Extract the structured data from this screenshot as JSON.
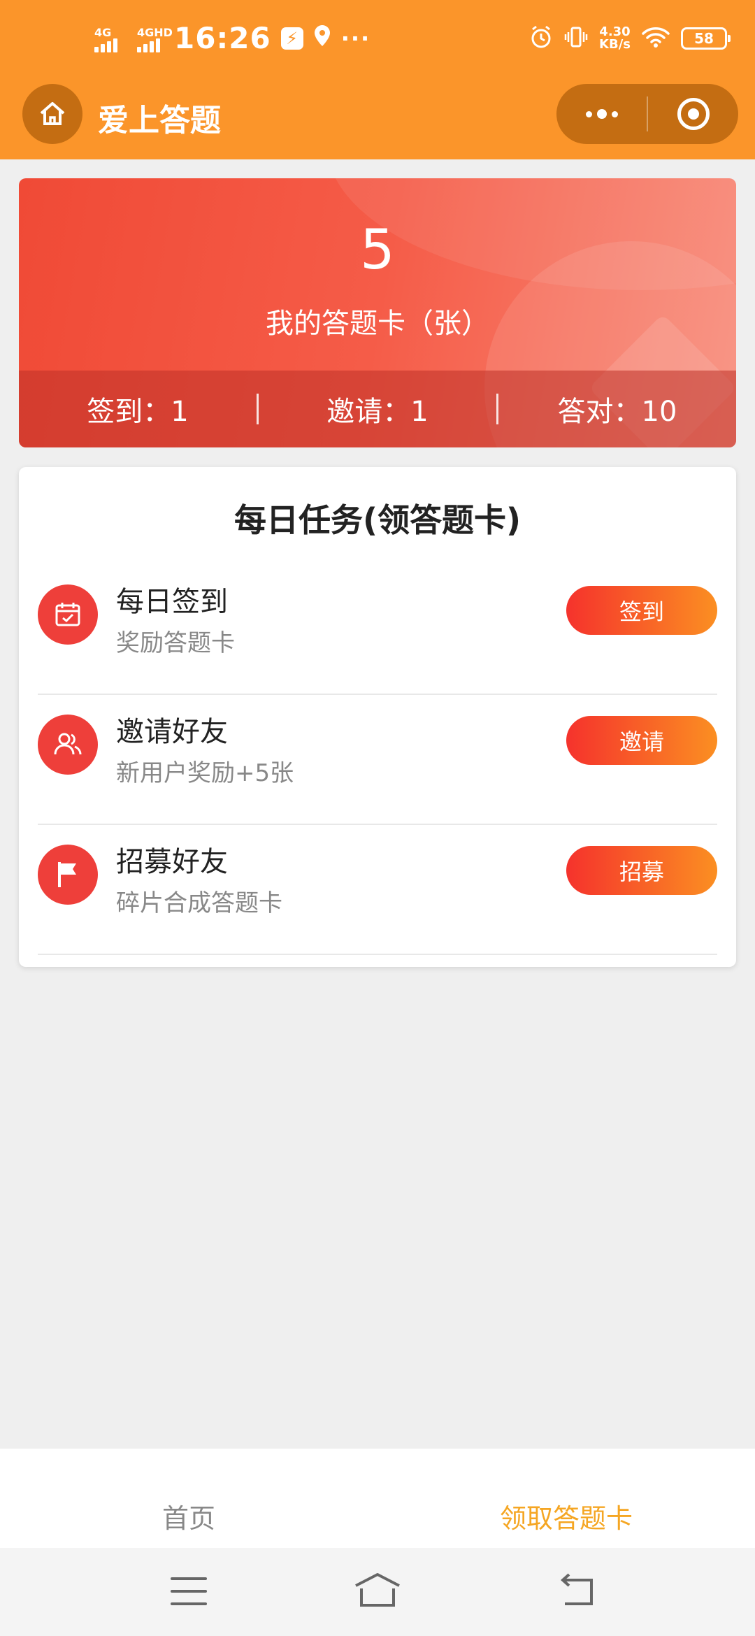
{
  "status_bar": {
    "net1": "4G",
    "net2": "4GHD",
    "time": "16:26",
    "more": "···",
    "speed_value": "4.30",
    "speed_unit": "KB/s",
    "battery": "58"
  },
  "nav": {
    "title": "爱上答题"
  },
  "banner": {
    "count": "5",
    "label": "我的答题卡（张）",
    "stats": [
      {
        "label": "签到：1"
      },
      {
        "label": "邀请：1"
      },
      {
        "label": "答对：10"
      }
    ]
  },
  "tasks": {
    "title": "每日任务(领答题卡)",
    "items": [
      {
        "name": "每日签到",
        "desc": "奖励答题卡",
        "button": "签到",
        "icon": "calendar-check-icon"
      },
      {
        "name": "邀请好友",
        "desc": "新用户奖励+5张",
        "button": "邀请",
        "icon": "users-icon"
      },
      {
        "name": "招募好友",
        "desc": "碎片合成答题卡",
        "button": "招募",
        "icon": "flag-icon"
      }
    ]
  },
  "tabbar": {
    "tabs": [
      {
        "label": "首页"
      },
      {
        "label": "领取答题卡"
      }
    ],
    "active_color": "#f5a623"
  },
  "colors": {
    "header": "#fb952a",
    "accent_red": "#ee3f3a"
  }
}
